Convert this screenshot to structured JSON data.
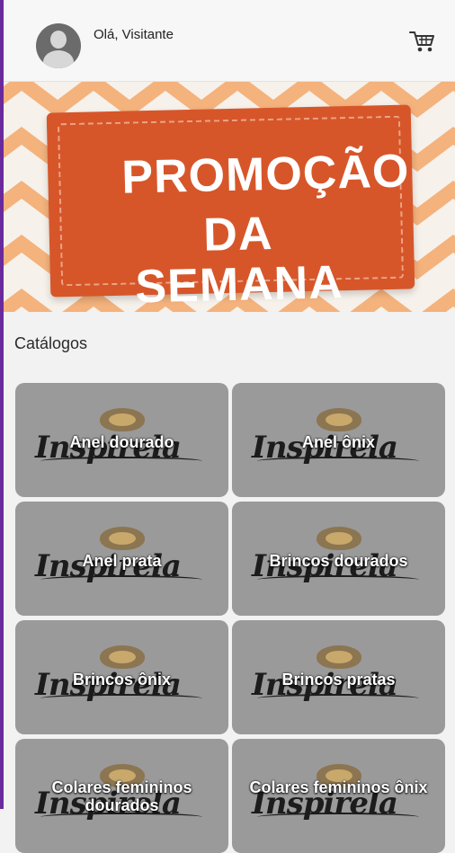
{
  "header": {
    "greeting": "Olá, Visitante",
    "avatar_icon": "user-avatar-icon",
    "cart_icon": "shopping-cart-icon"
  },
  "banner": {
    "line1": "PROMOÇÃO",
    "line2": "DA SEMANA",
    "colors": {
      "ticket": "#d6562a",
      "background_stripes": "#f4a86a"
    }
  },
  "catalog": {
    "title": "Catálogos",
    "watermark": "Inspirela",
    "items": [
      {
        "label": "Anel dourado"
      },
      {
        "label": "Anel ônix"
      },
      {
        "label": "Anel prata"
      },
      {
        "label": "Brincos dourados"
      },
      {
        "label": "Brincos ônix"
      },
      {
        "label": "Brincos pratas"
      },
      {
        "label": "Colares femininos dourados"
      },
      {
        "label": "Colares femininos ônix"
      }
    ]
  },
  "colors": {
    "accent_edge": "#6b2a9c",
    "card_background": "#9a9a9a"
  }
}
